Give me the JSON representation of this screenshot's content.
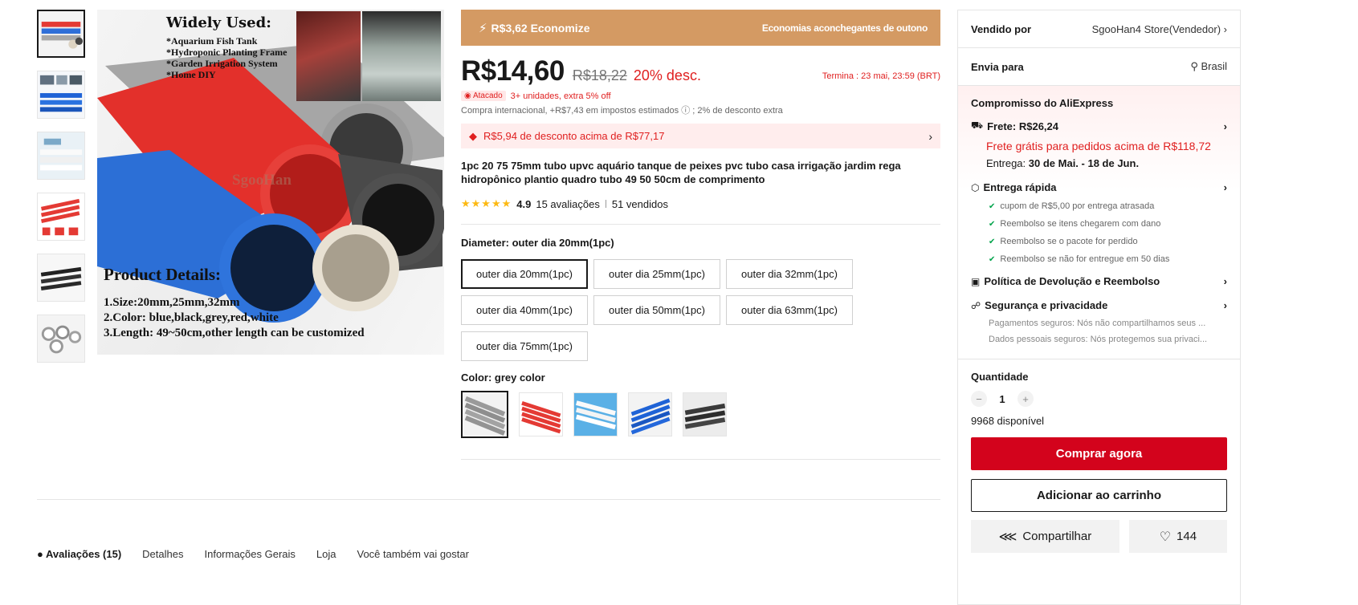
{
  "gallery": {
    "thumbnails": [
      {
        "name": "thumb-1"
      },
      {
        "name": "thumb-2"
      },
      {
        "name": "thumb-3"
      },
      {
        "name": "thumb-4"
      },
      {
        "name": "thumb-5"
      },
      {
        "name": "thumb-6"
      }
    ],
    "main_image": {
      "heading": "Widely Used:",
      "uses": [
        "*Aquarium Fish Tank",
        "*Hydroponic Planting Frame",
        "*Garden Irrigation System",
        "*Home DIY"
      ],
      "watermark": "SgooHan",
      "details_heading": "Product Details:",
      "details": [
        "1.Size:20mm,25mm,32mm",
        "2.Color: blue,black,grey,red,white",
        "3.Length: 49~50cm,other length can be customized"
      ]
    }
  },
  "promo": {
    "savings": "R$3,62 Economize",
    "campaign": "Economias aconchegantes de outono"
  },
  "price": {
    "current": "R$14,60",
    "original": "R$18,22",
    "discount": "20% desc.",
    "ends": "Termina :  23 mai, 23:59 (BRT)"
  },
  "wholesale": {
    "badge": "Atacado",
    "text": "3+ unidades, extra 5% off"
  },
  "tax_note": "Compra internacional, +R$7,43 em impostos estimados ⓘ ; 2% de desconto extra",
  "coupon": "R$5,94 de desconto acima de R$77,17",
  "product_title": "1pc 20 75 75mm tubo upvc aquário tanque de peixes pvc tubo casa irrigação jardim rega hidropônico plantio quadro tubo 49 50 50cm de comprimento",
  "rating": {
    "stars": "★★★★★",
    "score": "4.9",
    "reviews": "15 avaliações",
    "sold": "51 vendidos"
  },
  "diameter": {
    "label": "Diameter: outer dia 20mm(1pc)",
    "options": [
      "outer dia 20mm(1pc)",
      "outer dia 25mm(1pc)",
      "outer dia 32mm(1pc)",
      "outer dia 40mm(1pc)",
      "outer dia 50mm(1pc)",
      "outer dia 63mm(1pc)",
      "outer dia 75mm(1pc)"
    ],
    "selected_index": 0
  },
  "color": {
    "label": "Color: grey color",
    "swatches": [
      "grey",
      "red",
      "white",
      "blue",
      "black"
    ],
    "swatch_colors": [
      "#9a9a9a",
      "#e43a34",
      "#f1f4f6",
      "#1f63d6",
      "#3a3a3a"
    ],
    "selected_index": 0
  },
  "tabs": [
    "Avaliações (15)",
    "Detalhes",
    "Informações Gerais",
    "Loja",
    "Você também vai gostar"
  ],
  "sidebar": {
    "sold_by_label": "Vendido por",
    "sold_by_value": "SgooHan4 Store(Vendedor)",
    "ships_to_label": "Envia para",
    "ships_to_value": "Brasil",
    "commitment_title": "Compromisso do AliExpress",
    "shipping_title": "Frete: R$26,24",
    "shipping_free": "Frete grátis para pedidos acima de R$118,72",
    "delivery_label": "Entrega:",
    "delivery_value": "30 de Mai. - 18 de Jun.",
    "fast_title": "Entrega rápida",
    "fast_items": [
      "cupom de R$5,00 por entrega atrasada",
      "Reembolso se itens chegarem com dano",
      "Reembolso se o pacote for perdido",
      "Reembolso se não for entregue em 50 dias"
    ],
    "returns_title": "Política de Devolução e Reembolso",
    "security_title": "Segurança e privacidade",
    "security_items": [
      "Pagamentos seguros: Nós não compartilhamos seus ...",
      "Dados pessoais seguros: Nós protegemos sua privaci..."
    ],
    "quantity_label": "Quantidade",
    "quantity_value": "1",
    "available": "9968 disponível",
    "buy_now": "Comprar agora",
    "add_to_cart": "Adicionar ao carrinho",
    "share": "Compartilhar",
    "wishlist_count": "144"
  },
  "colors": {
    "accent_red": "#d3031c",
    "promo_bar": "#d49a63",
    "star": "#fdb913"
  }
}
